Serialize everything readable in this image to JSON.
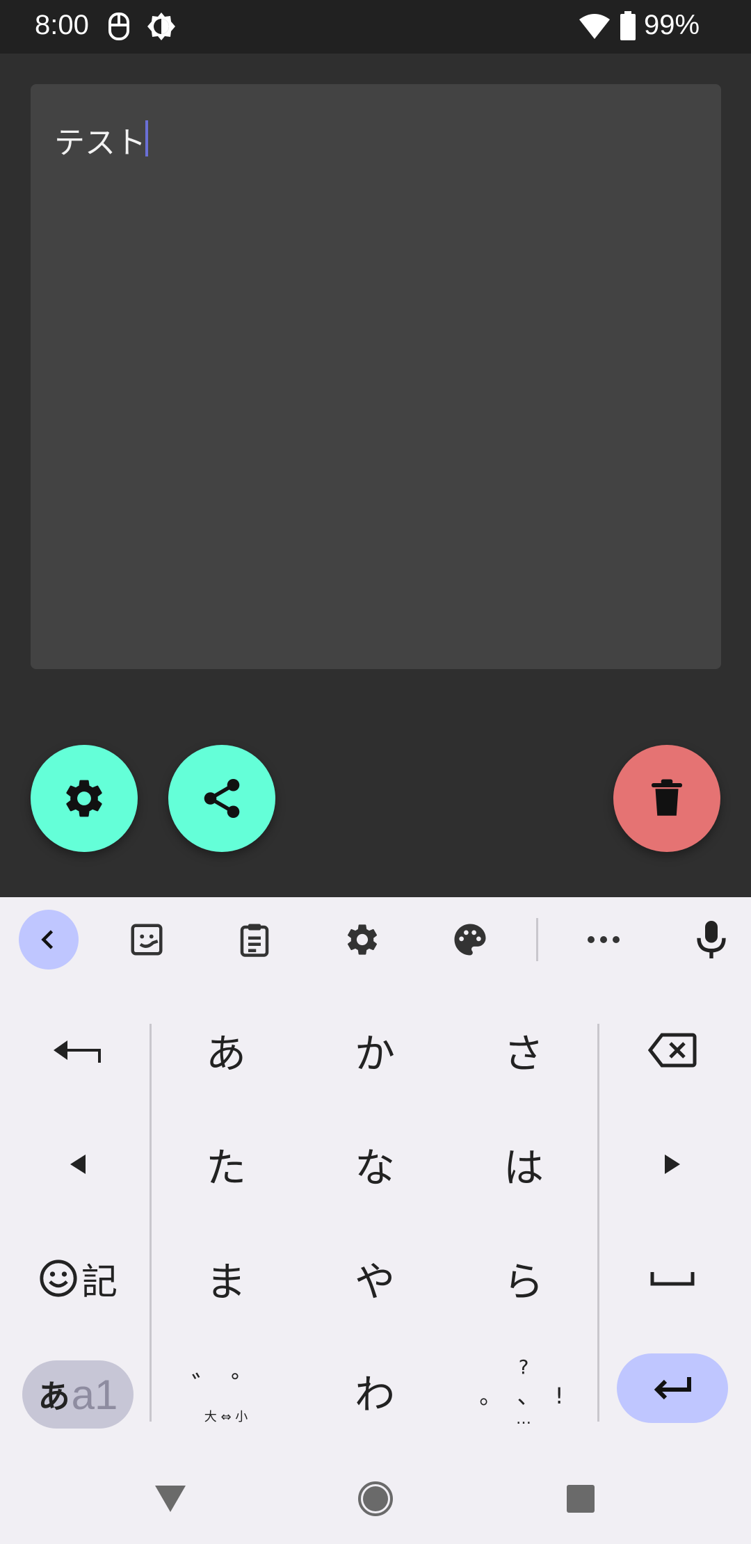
{
  "status_bar": {
    "time": "8:00",
    "battery_percent": "99%",
    "icons": [
      "mouse-icon",
      "brightness-icon",
      "wifi-icon",
      "battery-icon"
    ]
  },
  "note": {
    "text": "テスト"
  },
  "fabs": {
    "settings_icon": "gear-icon",
    "share_icon": "share-icon",
    "delete_icon": "trash-icon"
  },
  "keyboard": {
    "toolbar_icons": [
      "chevron-left-icon",
      "sticker-icon",
      "clipboard-icon",
      "gear-icon",
      "palette-icon",
      "more-icon",
      "microphone-icon"
    ],
    "rows": [
      [
        "あ",
        "か",
        "さ"
      ],
      [
        "た",
        "な",
        "は"
      ],
      [
        "ま",
        "や",
        "ら"
      ]
    ],
    "bottom": {
      "dakuten_top": "゛ ゜",
      "dakuten_bottom": "大 ⇔ 小",
      "wa": "わ",
      "punct_top": "?",
      "punct_mid": "。 、 !",
      "punct_bottom": "…"
    },
    "kigo_label": "記",
    "mode_label_kana": "あ",
    "mode_label_alnum": "a1"
  },
  "colors": {
    "accent_teal": "#64ffd8",
    "delete_red": "#e57373",
    "keyboard_accent": "#bfc6ff"
  }
}
